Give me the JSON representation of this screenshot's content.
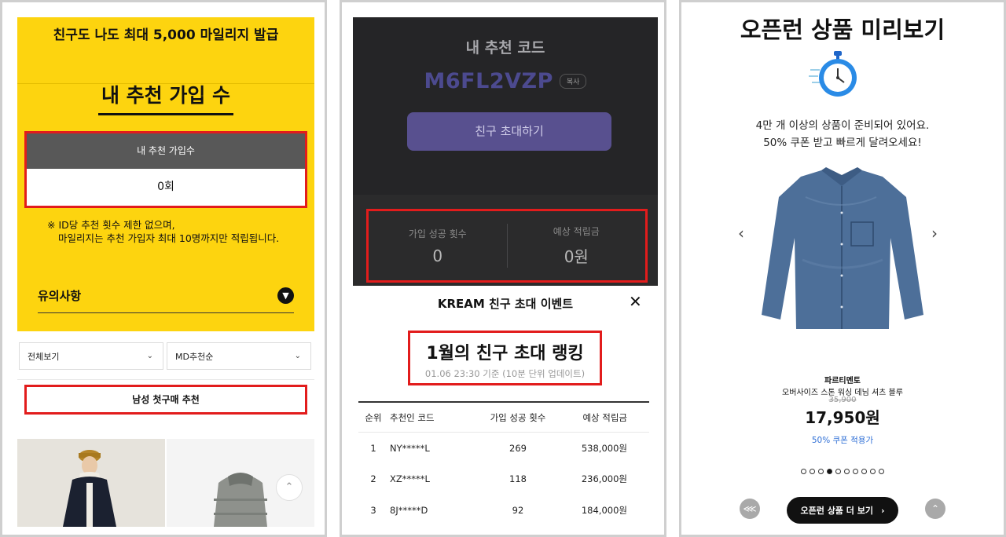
{
  "panel1": {
    "top_banner": "친구도 나도 최대 5,000 마일리지 발급",
    "section_title": "내 추천 가입 수",
    "count_header": "내 추천 가입수",
    "count_value": "0회",
    "note_line1": "※ ID당 추천 횟수 제한 없으며,",
    "note_line2": "마일리지는 추천 가입자 최대 10명까지만 적립됩니다.",
    "caution_label": "유의사항",
    "filter_all": "전체보기",
    "filter_sort": "MD추천순",
    "recommend_button": "남성 첫구매 추천",
    "colors": {
      "yellow": "#fdd40f",
      "highlight": "#e21c1c"
    }
  },
  "panel2": {
    "code_title": "내 추천 코드",
    "code": "M6FL2VZP",
    "copy_label": "복사",
    "invite_button": "친구 초대하기",
    "stat_success_label": "가입 성공 횟수",
    "stat_success_value": "0",
    "stat_reward_label": "예상 적립금",
    "stat_reward_value": "0원",
    "modal_title": "KREAM 친구 초대 이벤트",
    "ranking_title": "1월의 친구 초대 랭킹",
    "ranking_subtitle": "01.06 23:30 기준 (10분 단위 업데이트)",
    "table_headers": {
      "rank": "순위",
      "code": "추천인 코드",
      "count": "가입 성공 횟수",
      "amount": "예상 적립금"
    },
    "rows": [
      {
        "rank": "1",
        "code": "NY*****L",
        "count": "269",
        "amount": "538,000원"
      },
      {
        "rank": "2",
        "code": "XZ*****L",
        "count": "118",
        "amount": "236,000원"
      },
      {
        "rank": "3",
        "code": "8J*****D",
        "count": "92",
        "amount": "184,000원"
      }
    ],
    "colors": {
      "dark": "#252527",
      "accent": "#58508f"
    }
  },
  "panel3": {
    "title": "오픈런 상품 미리보기",
    "desc_line1": "4만 개 이상의 상품이 준비되어 있어요.",
    "desc_line2": "50% 쿠폰 받고 빠르게 달려오세요!",
    "brand": "파르티멘토",
    "product_name": "오버사이즈 스톤 워싱 데님 셔츠 블루",
    "original_price": "35,900",
    "price": "17,950원",
    "coupon_note": "50% 쿠폰 적용가",
    "more_button": "오픈런 상품 더 보기",
    "carousel_count": 10,
    "carousel_active": 4,
    "colors": {
      "coupon": "#2f6fd6"
    }
  }
}
